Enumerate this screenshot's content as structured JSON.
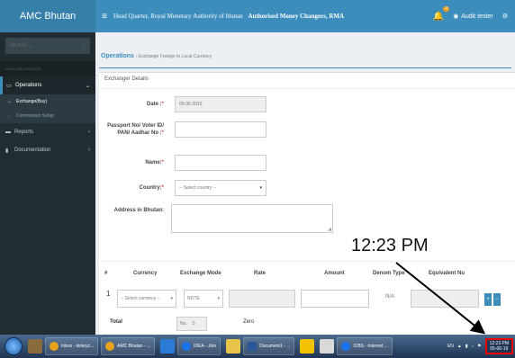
{
  "header": {
    "brand": "AMC Bhutan",
    "title": "Head Quarter, Royal Monetary Authority of bhutan",
    "subtitle": "Authorised Money Changers, RMA",
    "notif_count": "4",
    "user": "Audit tester"
  },
  "sidebar": {
    "search_placeholder": "Search...",
    "nav_header": "MAIN NAVIGATION",
    "items": [
      {
        "label": "Operations"
      },
      {
        "label": "Exchange(Buy)"
      },
      {
        "label": "Commission Setup"
      },
      {
        "label": "Reports"
      },
      {
        "label": "Documentation"
      }
    ]
  },
  "breadcrumb": {
    "title": "Operations",
    "sub": "› Exchange Foreign to Local Currency"
  },
  "form": {
    "section": "Exchanger Details",
    "date_label": "Date :",
    "date_value": "05-06-2019",
    "passport_label_1": "Passport No/ Voter ID/",
    "passport_label_2": "PAN/ Aadhar No :",
    "name_label": "Name:",
    "country_label": "Country:",
    "country_placeholder": "-- Select country --",
    "address_label": "Address in Bhutan:"
  },
  "table": {
    "headers": [
      "#",
      "Currency",
      "Exchange Mode",
      "Rate",
      "Amount",
      "Denom Type",
      "Equivalent Nu"
    ],
    "row_num": "1",
    "currency_placeholder": "-- Select currency --",
    "mode_value": "NOTE",
    "denom_value": "N/A",
    "total_label": "Total",
    "total_prefix": "Nu.",
    "total_value": "0",
    "total_words": "Zero"
  },
  "overlay": {
    "time": "12:23 PM"
  },
  "taskbar": {
    "items": [
      "Inbox - kinleyz...",
      "AMC Bhutan - ...",
      "IDEA - Join",
      "Document1 - ...",
      "ICBS - Internet ..."
    ],
    "lang": "EN",
    "clock_time": "12:23 PM",
    "clock_date": "05-06-19"
  },
  "colors": {
    "header": "#3c8dbc",
    "sidebar": "#222d32",
    "accent": "#3c8dbc",
    "required": "#dd4b39"
  }
}
